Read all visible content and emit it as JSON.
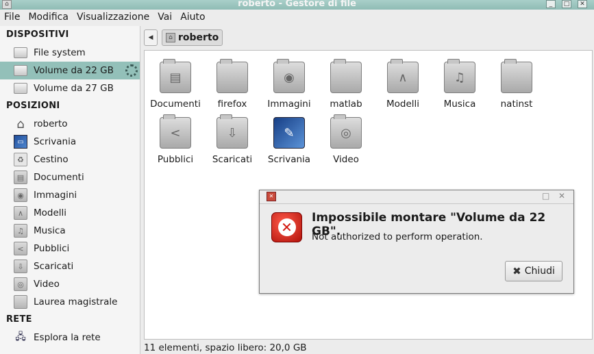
{
  "window": {
    "title": "roberto - Gestore di file"
  },
  "menu": [
    "File",
    "Modifica",
    "Visualizzazione",
    "Vai",
    "Aiuto"
  ],
  "sidebar": {
    "devices_header": "DISPOSITIVI",
    "devices": [
      {
        "label": "File system",
        "icon": "drive-icon"
      },
      {
        "label": "Volume da 22 GB",
        "icon": "drive-icon",
        "selected": true
      },
      {
        "label": "Volume da 27 GB",
        "icon": "drive-icon"
      }
    ],
    "places_header": "POSIZIONI",
    "places": [
      {
        "label": "roberto",
        "icon": "home-icon"
      },
      {
        "label": "Scrivania",
        "icon": "desktop-icon"
      },
      {
        "label": "Cestino",
        "icon": "trash-icon"
      },
      {
        "label": "Documenti",
        "icon": "documents-folder-icon"
      },
      {
        "label": "Immagini",
        "icon": "pictures-folder-icon"
      },
      {
        "label": "Modelli",
        "icon": "templates-folder-icon"
      },
      {
        "label": "Musica",
        "icon": "music-folder-icon"
      },
      {
        "label": "Pubblici",
        "icon": "public-folder-icon"
      },
      {
        "label": "Scaricati",
        "icon": "downloads-folder-icon"
      },
      {
        "label": "Video",
        "icon": "videos-folder-icon"
      },
      {
        "label": "Laurea magistrale",
        "icon": "folder-icon"
      }
    ],
    "network_header": "RETE",
    "network": [
      {
        "label": "Esplora la rete",
        "icon": "network-icon"
      }
    ]
  },
  "pathbar": {
    "current": "roberto"
  },
  "files": [
    {
      "name": "Documenti",
      "icon": "documents-folder-icon"
    },
    {
      "name": "firefox",
      "icon": "folder-icon"
    },
    {
      "name": "Immagini",
      "icon": "pictures-folder-icon"
    },
    {
      "name": "matlab",
      "icon": "folder-icon"
    },
    {
      "name": "Modelli",
      "icon": "templates-folder-icon"
    },
    {
      "name": "Musica",
      "icon": "music-folder-icon"
    },
    {
      "name": "natinst",
      "icon": "folder-icon"
    },
    {
      "name": "Pubblici",
      "icon": "public-folder-icon"
    },
    {
      "name": "Scaricati",
      "icon": "downloads-folder-icon"
    },
    {
      "name": "Scrivania",
      "icon": "desktop-icon"
    },
    {
      "name": "Video",
      "icon": "videos-folder-icon"
    }
  ],
  "statusbar": {
    "text": "11 elementi, spazio libero: 20,0 GB"
  },
  "dialog": {
    "heading": "Impossibile montare \"Volume da 22 GB\".",
    "message": "Not authorized to perform operation.",
    "close_label": "Chiudi"
  }
}
